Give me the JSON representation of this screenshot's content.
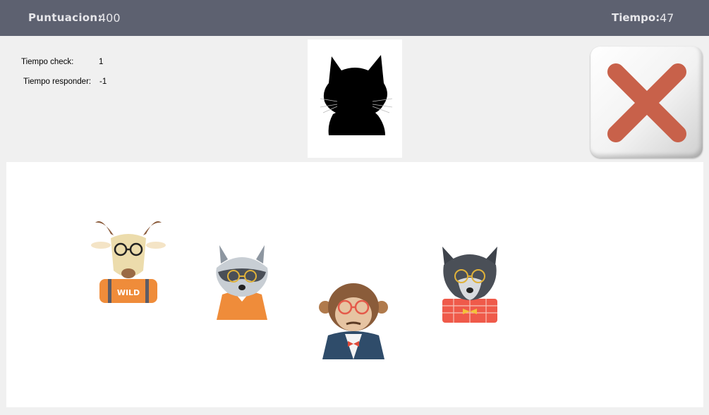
{
  "header": {
    "score_label": "Puntuacion:",
    "score_value": "400",
    "time_label": "Tiempo:",
    "time_value": "47"
  },
  "info": {
    "check_label": "Tiempo check:",
    "check_value": "1",
    "respond_label": "Tiempo responder:",
    "respond_value": "-1"
  },
  "target": {
    "icon": "cat-silhouette-icon"
  },
  "close_button": {
    "icon": "close-x-icon",
    "color": "#c8614a"
  },
  "animals": [
    {
      "name": "goat",
      "shirt_text": "WILD",
      "glasses": "black"
    },
    {
      "name": "raccoon",
      "glasses": "yellow"
    },
    {
      "name": "monkey",
      "glasses": "red"
    },
    {
      "name": "wolf",
      "glasses": "yellow"
    }
  ],
  "colors": {
    "topbar": "#5d6170",
    "background": "#f0f0f0",
    "panel": "#ffffff"
  }
}
